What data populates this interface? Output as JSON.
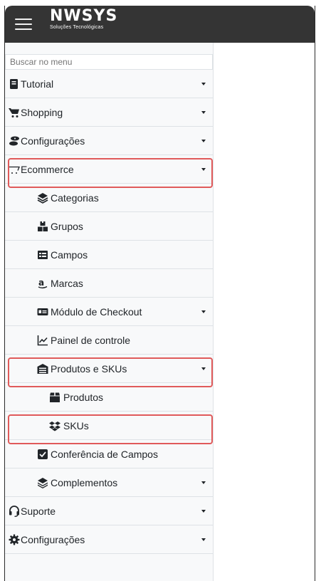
{
  "brand": {
    "name": "NWSYS",
    "tagline": "Soluções Tecnológicas"
  },
  "search": {
    "placeholder": "Buscar no menu"
  },
  "menu": {
    "tutorial": "Tutorial",
    "shopping": "Shopping",
    "configuracoes": "Configurações",
    "ecommerce": "Ecommerce",
    "categorias": "Categorias",
    "grupos": "Grupos",
    "campos": "Campos",
    "marcas": "Marcas",
    "checkout": "Módulo de Checkout",
    "painel": "Painel de controle",
    "produtos_skus": "Produtos e SKUs",
    "produtos": "Produtos",
    "skus": "SKUs",
    "conferencia": "Conferência de Campos",
    "complementos": "Complementos",
    "suporte": "Suporte",
    "configuracoes2": "Configurações"
  },
  "icons": {
    "tutorial": "book-icon",
    "shopping": "cart-icon",
    "configuracoes": "settings-icon",
    "ecommerce": "cart-outline-icon",
    "categorias": "layers-icon",
    "grupos": "boxes-icon",
    "campos": "table-icon",
    "marcas": "amazon-icon",
    "checkout": "id-card-icon",
    "painel": "chart-line-icon",
    "produtos_skus": "warehouse-icon",
    "produtos": "box-icon",
    "skus": "dropbox-icon",
    "conferencia": "check-square-icon",
    "complementos": "layer-group-icon",
    "suporte": "headset-icon",
    "configuracoes2": "cog-icon"
  },
  "colors": {
    "topbar": "#343434",
    "sidebar_bg": "#f8f9fa",
    "highlight": "#e05a5a"
  }
}
